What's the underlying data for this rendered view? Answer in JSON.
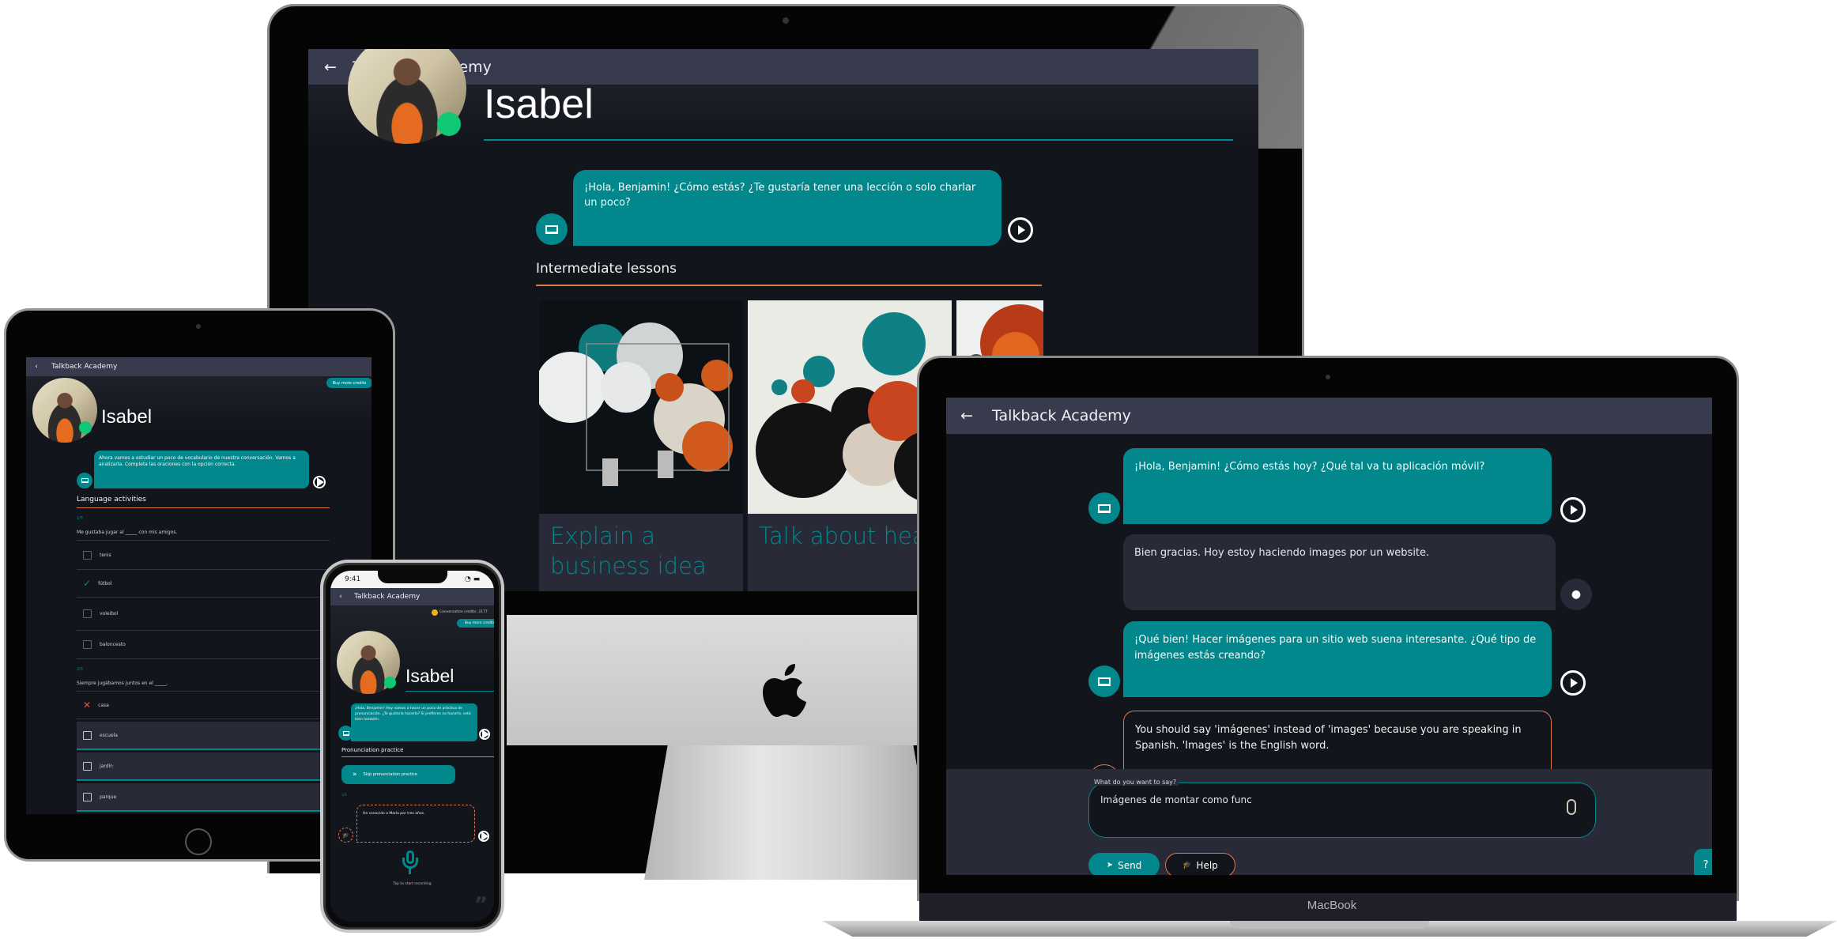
{
  "app": {
    "title": "Talkback Academy",
    "back_icon": "arrow-left-icon",
    "colors": {
      "accent_teal": "#02888C",
      "accent_orange": "#E07A4A",
      "background": "#13151D",
      "app_bar": "#383A4E",
      "user_bubble": "#282A38",
      "online_green": "#0FC774",
      "error_red": "#E0533A"
    }
  },
  "imac": {
    "tutor_name": "Isabel",
    "message": "¡Hola, Benjamin! ¿Cómo estás? ¿Te gustaría tener una lección o solo charlar un poco?",
    "section_title": "Intermediate lessons",
    "lessons": [
      {
        "title": "Explain a business idea"
      },
      {
        "title": "Talk about health and exercise"
      },
      {
        "title": ""
      }
    ]
  },
  "tablet": {
    "tutor_name": "Isabel",
    "buy_credits_label": "Buy more credits",
    "message": "Ahora vamos a estudiar un poco de vocabulario de nuestra conversación. Vamos a analizarla. Completa las oraciones con la opción correcta.",
    "section_title": "Language activities",
    "questions": [
      {
        "counter": "1/5",
        "prompt": "Me gustaba jugar al _____ con mis amigos.",
        "options": [
          {
            "label": "tenis",
            "state": "unchecked"
          },
          {
            "label": "fútbol",
            "state": "correct"
          },
          {
            "label": "voleibol",
            "state": "unchecked"
          },
          {
            "label": "baloncesto",
            "state": "unchecked"
          }
        ]
      },
      {
        "counter": "2/5",
        "prompt": "Siempre jugábamos juntos en el _____.",
        "options": [
          {
            "label": "casa",
            "state": "wrong"
          },
          {
            "label": "escuela",
            "state": "unchecked"
          },
          {
            "label": "jardín",
            "state": "unchecked"
          },
          {
            "label": "parque",
            "state": "unchecked"
          }
        ]
      }
    ]
  },
  "phone": {
    "status_time": "9:41",
    "credits_label": "Conversation credits: 2177",
    "buy_credits_label": "Buy more credits",
    "tutor_name": "Isabel",
    "message": "¡Hola, Benjamin! Hoy vamos a hacer un poco de práctica de pronunciación. ¿Te gustaría hacerlo? Si prefieres no hacerlo, está bien también.",
    "section_title": "Pronunciation practice",
    "skip_label": "Skip pronunciation practice",
    "counter": "1/3",
    "phrase": "He conocido a María por tres años.",
    "record_hint": "Tap to start recording"
  },
  "laptop": {
    "brand_label": "MacBook",
    "messages": [
      {
        "role": "tutor",
        "text": "¡Hola, Benjamin! ¿Cómo estás hoy? ¿Qué tal va tu aplicación móvil?"
      },
      {
        "role": "user",
        "text": "Bien gracias. Hoy estoy haciendo images por un website."
      },
      {
        "role": "tutor",
        "text": "¡Qué bien! Hacer imágenes para un sitio web suena interesante. ¿Qué tipo de imágenes estás creando?"
      },
      {
        "role": "hint",
        "text": "You should say 'imágenes' instead of 'images' because you are speaking in Spanish. 'Images' is the English word."
      }
    ],
    "input_label": "What do you want to say?",
    "input_value": "Imágenes de montar como func",
    "send_label": "Send",
    "help_label": "Help"
  }
}
